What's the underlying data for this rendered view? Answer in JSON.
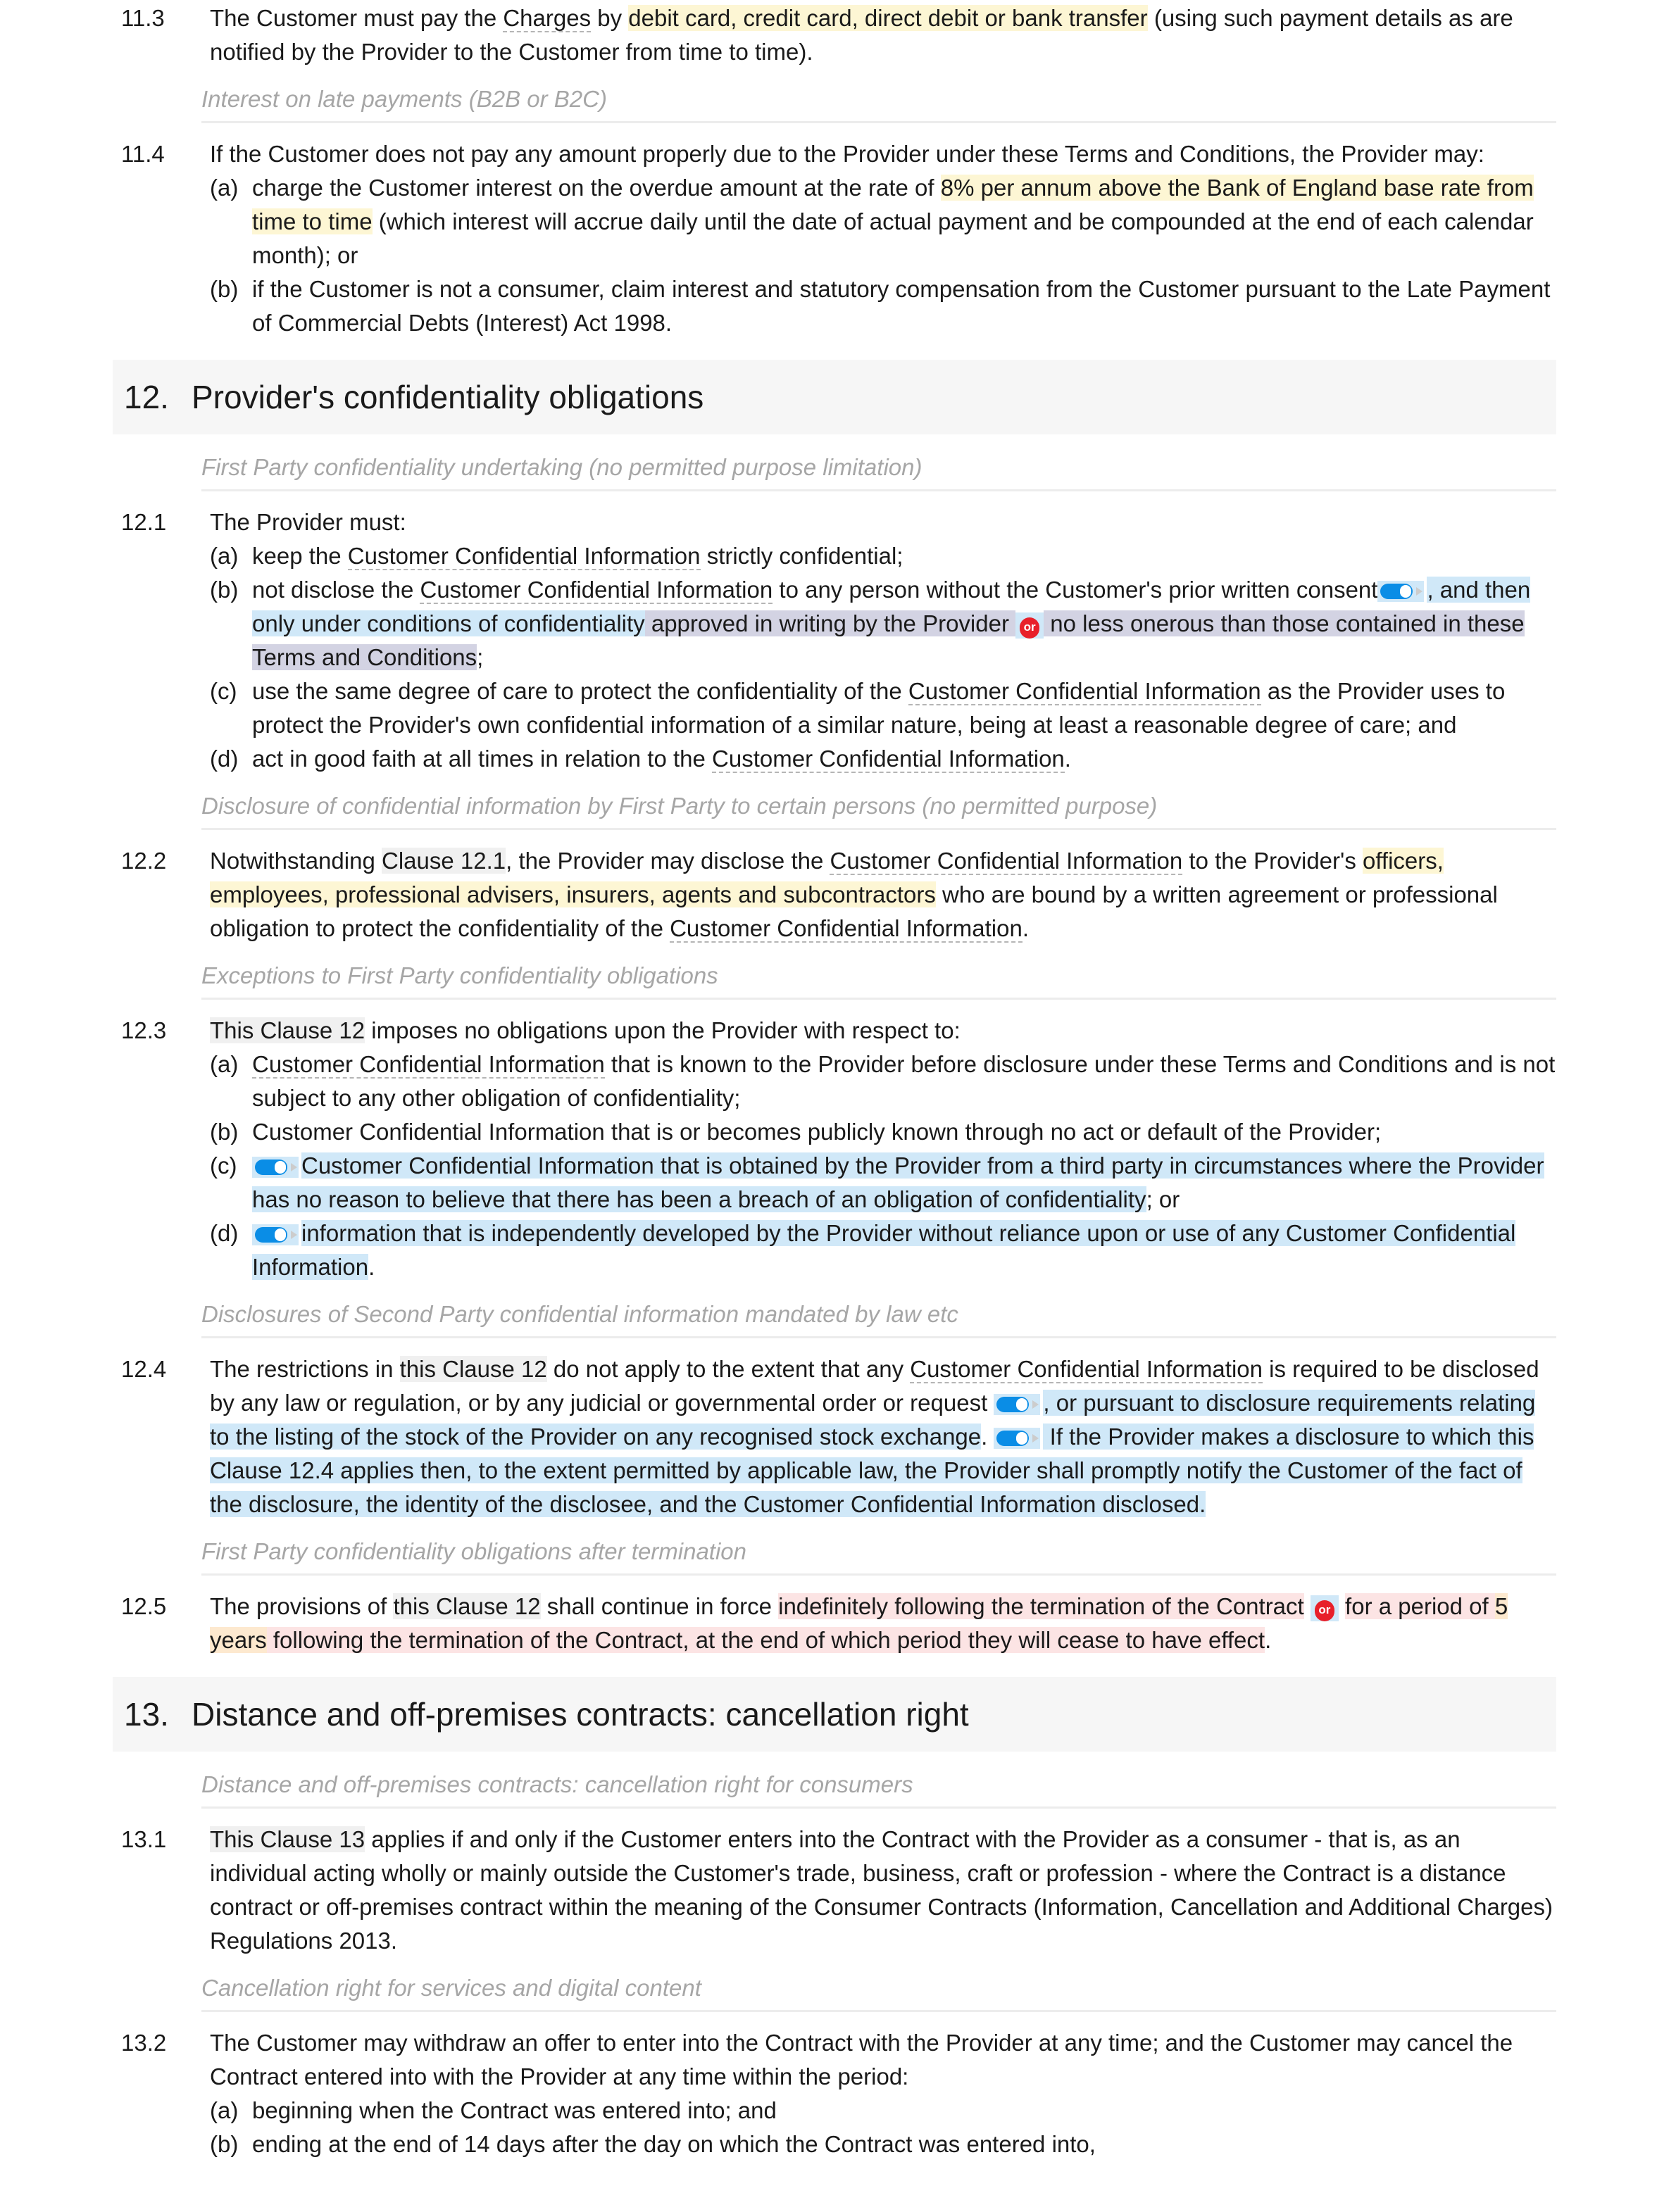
{
  "colors": {
    "highlight_yellow": "#fdf6d4",
    "highlight_blue": "#d0e8f8",
    "highlight_purple": "#d3d3e3",
    "highlight_red": "#fce4e4",
    "highlight_orange": "#fde9cf",
    "or_badge": "#e8202a",
    "toggle": "#0a8de6"
  },
  "icons": {
    "toggle": "toggle-switch-icon",
    "or": "or-badge-icon"
  },
  "blocks": [
    {
      "type": "clause",
      "num": "11.3",
      "segs": [
        [
          "The Customer must pay the ",
          ""
        ],
        [
          "Charges",
          "term"
        ],
        [
          " by ",
          ""
        ],
        [
          "debit card, credit card, direct debit or bank transfer",
          "y"
        ],
        [
          " (using such payment details as are notified by the Provider to the Customer from time to time).",
          ""
        ]
      ]
    },
    {
      "type": "note",
      "text": "Interest on late payments (B2B or B2C)"
    },
    {
      "type": "clause",
      "num": "11.4",
      "segs": [
        [
          "If the Customer does not pay any amount properly due to the Provider under these Terms and Conditions, the Provider may:",
          ""
        ]
      ],
      "subs": [
        {
          "label": "(a)",
          "segs": [
            [
              "charge the Customer interest on the overdue amount at the rate of ",
              ""
            ],
            [
              "8% per annum above the Bank of England base rate from time to time",
              "y"
            ],
            [
              " (which interest will accrue daily until the date of actual payment and be compounded at the end of each calendar month); or",
              ""
            ]
          ]
        },
        {
          "label": "(b)",
          "segs": [
            [
              "if the Customer is not a consumer, claim interest and statutory compensation from the Customer pursuant to the Late Payment of Commercial Debts (Interest) Act 1998.",
              ""
            ]
          ]
        }
      ]
    },
    {
      "type": "heading",
      "num": "12.",
      "title": "Provider's confidentiality obligations"
    },
    {
      "type": "note",
      "text": "First Party confidentiality undertaking (no permitted purpose limitation)"
    },
    {
      "type": "clause",
      "num": "12.1",
      "segs": [
        [
          "The Provider must:",
          ""
        ]
      ],
      "subs": [
        {
          "label": "(a)",
          "segs": [
            [
              "keep the ",
              ""
            ],
            [
              "Customer Confidential Information",
              "term"
            ],
            [
              " strictly confidential;",
              ""
            ]
          ]
        },
        {
          "label": "(b)",
          "segs": [
            [
              "not disclose the ",
              ""
            ],
            [
              "Customer Confidential Information",
              "term"
            ],
            [
              " to any person without the Customer's prior written consent",
              ""
            ],
            [
              "",
              "toggle"
            ],
            [
              ", and then only under conditions of confidentiality",
              "b"
            ],
            [
              " approved in writing by the Provider ",
              "p"
            ],
            [
              "or",
              "or"
            ],
            [
              " no less onerous than those contained in these Terms and Conditions",
              "p"
            ],
            [
              ";",
              ""
            ]
          ]
        },
        {
          "label": "(c)",
          "segs": [
            [
              "use the same degree of care to protect the confidentiality of the ",
              ""
            ],
            [
              "Customer Confidential Information",
              "term"
            ],
            [
              " as the Provider uses to protect the Provider's own confidential information of a similar nature, being at least a reasonable degree of care; and",
              ""
            ]
          ]
        },
        {
          "label": "(d)",
          "segs": [
            [
              "act in good faith at all times in relation to the ",
              ""
            ],
            [
              "Customer Confidential Information",
              "term"
            ],
            [
              ".",
              ""
            ]
          ]
        }
      ]
    },
    {
      "type": "note",
      "text": "Disclosure of confidential information by First Party to certain persons (no permitted purpose)"
    },
    {
      "type": "clause",
      "num": "12.2",
      "segs": [
        [
          "Notwithstanding ",
          ""
        ],
        [
          "Clause 12.1",
          "ref"
        ],
        [
          ", the Provider may disclose the ",
          ""
        ],
        [
          "Customer Confidential Information",
          "term"
        ],
        [
          " to the Provider's ",
          ""
        ],
        [
          "officers, employees, professional advisers, insurers, agents and subcontractors",
          "y"
        ],
        [
          " who are bound by a written agreement or professional obligation to protect the confidentiality of the ",
          ""
        ],
        [
          "Customer Confidential Information",
          "term"
        ],
        [
          ".",
          ""
        ]
      ]
    },
    {
      "type": "note",
      "text": "Exceptions to First Party confidentiality obligations"
    },
    {
      "type": "clause",
      "num": "12.3",
      "segs": [
        [
          "This Clause 12",
          "ref"
        ],
        [
          " imposes no obligations upon the Provider with respect to:",
          ""
        ]
      ],
      "subs": [
        {
          "label": "(a)",
          "segs": [
            [
              "Customer Confidential Information",
              "term"
            ],
            [
              " that is known to the Provider before disclosure under these Terms and Conditions and is not subject to any other obligation of confidentiality;",
              ""
            ]
          ]
        },
        {
          "label": "(b)",
          "segs": [
            [
              "Customer Confidential Information that is or becomes publicly known through no act or default of the Provider;",
              ""
            ]
          ]
        },
        {
          "label": "(c)",
          "segs": [
            [
              "",
              "toggle"
            ],
            [
              "Customer Confidential Information that is obtained by the Provider from a third party in circumstances where the Provider has no reason to believe that there has been a breach of an obligation of confidentiality",
              "b"
            ],
            [
              "; or",
              ""
            ]
          ]
        },
        {
          "label": "(d)",
          "segs": [
            [
              "",
              "toggle"
            ],
            [
              "information that is independently developed by the Provider without reliance upon or use of any Customer Confidential Information",
              "b"
            ],
            [
              ".",
              ""
            ]
          ]
        }
      ]
    },
    {
      "type": "note",
      "text": "Disclosures of Second Party confidential information mandated by law etc"
    },
    {
      "type": "clause",
      "num": "12.4",
      "segs": [
        [
          "The restrictions in ",
          ""
        ],
        [
          "this Clause 12",
          "ref"
        ],
        [
          " do not apply to the extent that any ",
          ""
        ],
        [
          "Customer Confidential Information",
          "term"
        ],
        [
          " is required to be disclosed by any law or regulation, or by any judicial or governmental order or request ",
          ""
        ],
        [
          "",
          "toggle"
        ],
        [
          ", or pursuant to disclosure requirements relating to the listing of the stock of the Provider on any recognised stock exchange",
          "b"
        ],
        [
          ". ",
          ""
        ],
        [
          "",
          "toggle"
        ],
        [
          " If the Provider makes a disclosure to which this Clause 12.4 applies then, to the extent permitted by applicable law, the Provider shall promptly notify the Customer of the fact of the disclosure, the identity of the disclosee, and the Customer Confidential Information disclosed.",
          "b"
        ]
      ]
    },
    {
      "type": "note",
      "text": "First Party confidentiality obligations after termination"
    },
    {
      "type": "clause",
      "num": "12.5",
      "segs": [
        [
          "The provisions of ",
          ""
        ],
        [
          "this Clause 12",
          "ref"
        ],
        [
          " shall continue in force ",
          ""
        ],
        [
          "indefinitely following the termination of the Contract",
          "r"
        ],
        [
          " ",
          ""
        ],
        [
          "or",
          "or"
        ],
        [
          " ",
          ""
        ],
        [
          "for a period of ",
          "r"
        ],
        [
          "5 years",
          "o"
        ],
        [
          " following the termination of the Contract, at the end of which period they will cease to have effect",
          "r"
        ],
        [
          ".",
          ""
        ]
      ]
    },
    {
      "type": "heading",
      "num": "13.",
      "title": "Distance and off-premises contracts: cancellation right"
    },
    {
      "type": "note",
      "text": "Distance and off-premises contracts: cancellation right for consumers"
    },
    {
      "type": "clause",
      "num": "13.1",
      "segs": [
        [
          "This Clause 13",
          "ref"
        ],
        [
          " applies if and only if the Customer enters into the Contract with the Provider as a consumer - that is, as an individual acting wholly or mainly outside the Customer's trade, business, craft or profession - where the Contract is a distance contract or off-premises contract within the meaning of the Consumer Contracts (Information, Cancellation and Additional Charges) Regulations 2013.",
          ""
        ]
      ]
    },
    {
      "type": "note",
      "text": "Cancellation right for services and digital content"
    },
    {
      "type": "clause",
      "num": "13.2",
      "segs": [
        [
          "The Customer may withdraw an offer to enter into the Contract with the Provider at any time; and the Customer may cancel the Contract entered into with the Provider at any time within the period:",
          ""
        ]
      ],
      "subs": [
        {
          "label": "(a)",
          "segs": [
            [
              "beginning when the Contract was entered into; and",
              ""
            ]
          ]
        },
        {
          "label": "(b)",
          "segs": [
            [
              "ending at the end of 14 days after the day on which the Contract was entered into,",
              ""
            ]
          ]
        }
      ]
    }
  ]
}
